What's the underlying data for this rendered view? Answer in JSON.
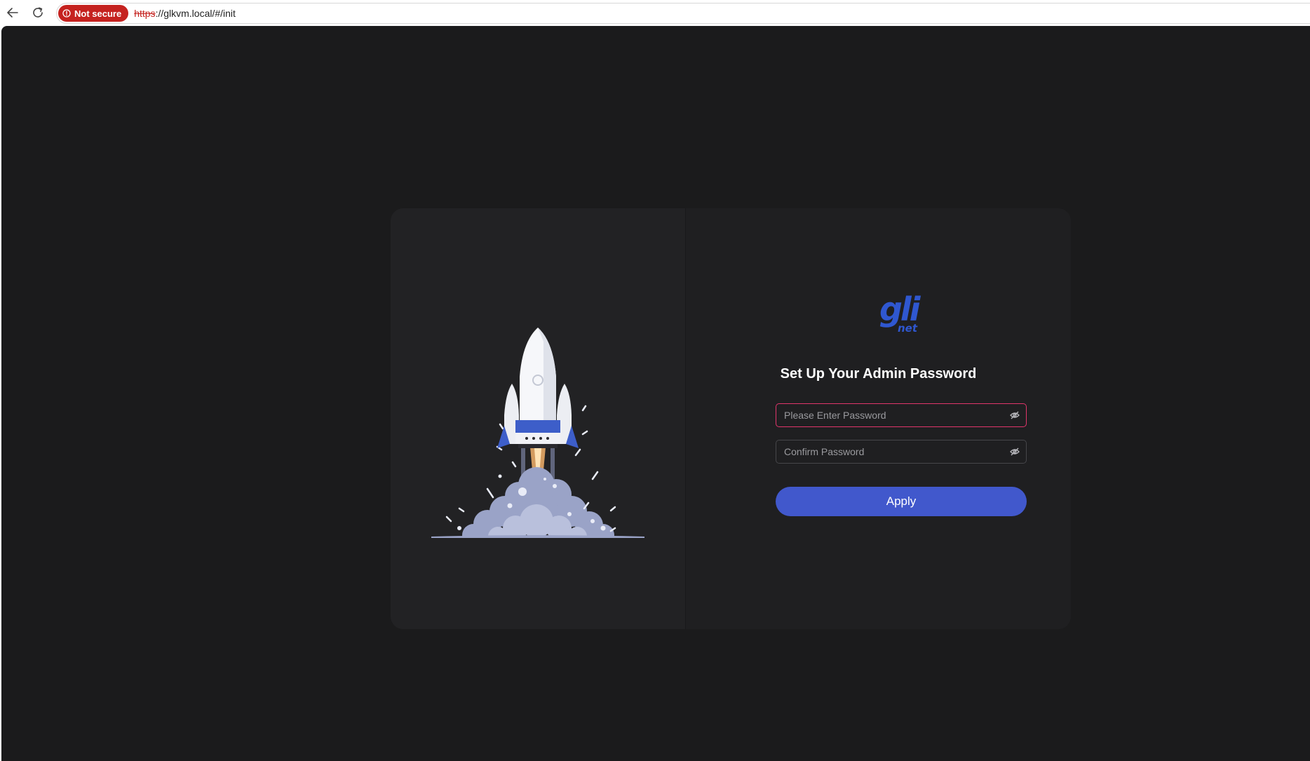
{
  "browser": {
    "back_icon": "arrow-left-icon",
    "reload_icon": "reload-icon",
    "security_label": "Not secure",
    "security_icon": "shield-warning-icon",
    "url_scheme": "https",
    "url_rest": "://glkvm.local/#/init"
  },
  "logo": {
    "text": "gli",
    "subtext": "net",
    "color": "#2f57d0"
  },
  "form": {
    "title": "Set Up Your Admin Password",
    "password_placeholder": "Please Enter Password",
    "confirm_placeholder": "Confirm Password",
    "visibility_icon": "eye-off-icon",
    "apply_label": "Apply"
  },
  "illustration": {
    "icon": "rocket-launch-illustration"
  },
  "colors": {
    "page_background": "#1b1b1c",
    "card_background": "#212123",
    "accent": "#4158cc",
    "active_border": "#e0356b",
    "insecure": "#c5221f"
  }
}
